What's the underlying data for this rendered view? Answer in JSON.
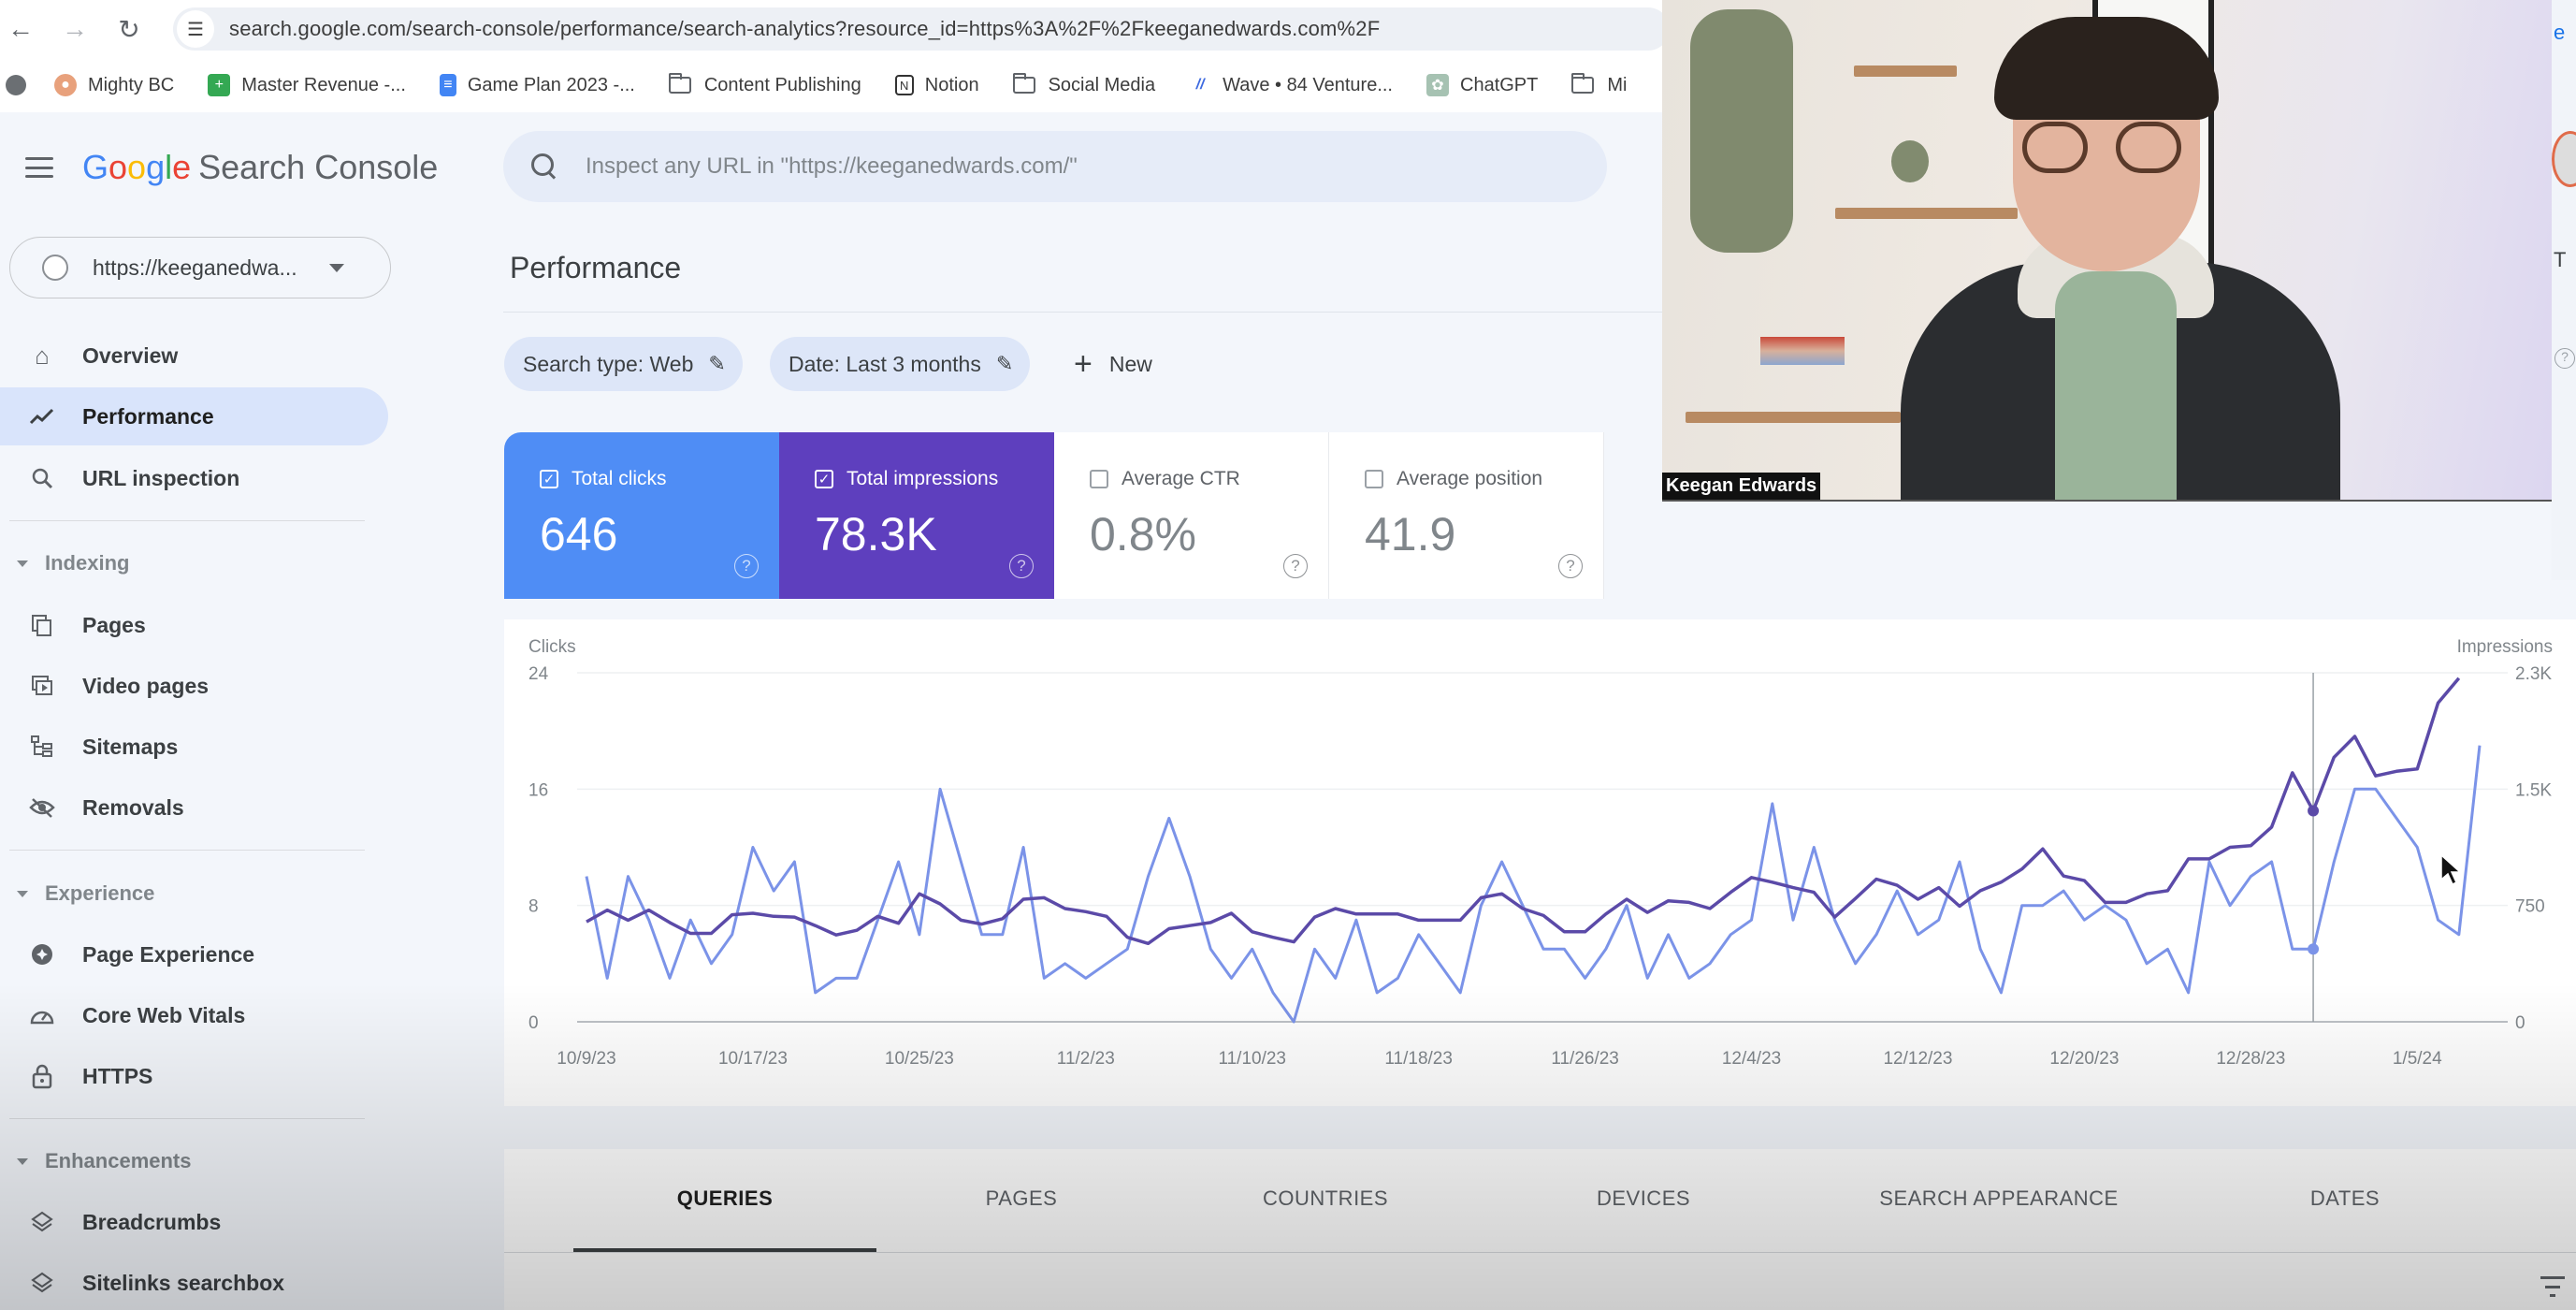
{
  "browser": {
    "url": "search.google.com/search-console/performance/search-analytics?resource_id=https%3A%2F%2Fkeeganedwards.com%2F",
    "bookmarks": [
      {
        "label": "Mighty BC",
        "icon": "mighty-bc-icon",
        "color": "#e8a17c"
      },
      {
        "label": "Master Revenue -...",
        "icon": "sheets-icon",
        "color": "#34a853"
      },
      {
        "label": "Game Plan 2023 -...",
        "icon": "docs-icon",
        "color": "#4285f4"
      },
      {
        "label": "Content Publishing",
        "icon": "folder-icon"
      },
      {
        "label": "Notion",
        "icon": "notion-icon",
        "color": "#333333"
      },
      {
        "label": "Social Media",
        "icon": "folder-icon"
      },
      {
        "label": "Wave • 84 Venture...",
        "icon": "wave-icon",
        "color": "#3d6ae0"
      },
      {
        "label": "ChatGPT",
        "icon": "chatgpt-icon",
        "color": "#a6c2b2"
      },
      {
        "label": "Mi",
        "icon": "folder-icon"
      }
    ]
  },
  "sidebar": {
    "product_name": "Search Console",
    "logo_letters": [
      "G",
      "o",
      "o",
      "g",
      "l",
      "e"
    ],
    "property": "https://keeganedwa...",
    "top_items": [
      {
        "label": "Overview",
        "icon": "home-icon"
      },
      {
        "label": "Performance",
        "icon": "trending-up-icon",
        "active": true
      },
      {
        "label": "URL inspection",
        "icon": "search-icon"
      }
    ],
    "sections": [
      {
        "title": "Indexing",
        "items": [
          {
            "label": "Pages",
            "icon": "pages-icon"
          },
          {
            "label": "Video pages",
            "icon": "video-pages-icon"
          },
          {
            "label": "Sitemaps",
            "icon": "sitemap-icon"
          },
          {
            "label": "Removals",
            "icon": "eye-off-icon"
          }
        ]
      },
      {
        "title": "Experience",
        "items": [
          {
            "label": "Page Experience",
            "icon": "page-experience-icon"
          },
          {
            "label": "Core Web Vitals",
            "icon": "speedometer-icon"
          },
          {
            "label": "HTTPS",
            "icon": "lock-icon"
          }
        ]
      },
      {
        "title": "Enhancements",
        "items": [
          {
            "label": "Breadcrumbs",
            "icon": "layers-icon"
          },
          {
            "label": "Sitelinks searchbox",
            "icon": "layers-icon"
          }
        ]
      }
    ]
  },
  "main": {
    "search_placeholder": "Inspect any URL in \"https://keeganedwards.com/\"",
    "page_title": "Performance",
    "filters": [
      {
        "label": "Search type: Web"
      },
      {
        "label": "Date: Last 3 months"
      }
    ],
    "new_label": "New",
    "metrics": [
      {
        "label": "Total clicks",
        "value": "646",
        "checked": true,
        "color": "#4f8df5"
      },
      {
        "label": "Total impressions",
        "value": "78.3K",
        "checked": true,
        "color": "#5e3fbe"
      },
      {
        "label": "Average CTR",
        "value": "0.8%",
        "checked": false
      },
      {
        "label": "Average position",
        "value": "41.9",
        "checked": false
      }
    ],
    "tabs": [
      {
        "label": "QUERIES",
        "active": true
      },
      {
        "label": "PAGES"
      },
      {
        "label": "COUNTRIES"
      },
      {
        "label": "DEVICES"
      },
      {
        "label": "SEARCH APPEARANCE"
      },
      {
        "label": "DATES"
      }
    ]
  },
  "webcam": {
    "participant_name": "Keegan Edwards"
  },
  "chart_data": {
    "type": "line",
    "title": "",
    "left_axis_label": "Clicks",
    "right_axis_label": "Impressions",
    "left_ylim": [
      0,
      24
    ],
    "left_ticks": [
      "0",
      "8",
      "16",
      "24"
    ],
    "right_ylim": [
      0,
      2250
    ],
    "right_ticks": [
      "0",
      "750",
      "1.5K",
      "2.3K"
    ],
    "x_tick_labels": [
      "10/9/23",
      "10/17/23",
      "10/25/23",
      "11/2/23",
      "11/10/23",
      "11/18/23",
      "11/26/23",
      "12/4/23",
      "12/12/23",
      "12/20/23",
      "12/28/23",
      "1/5/24"
    ],
    "x_tick_every_days": 8,
    "start_date": "10/9/23",
    "end_date": "1/8/24",
    "grid": true,
    "hover_date_index": 83,
    "series": [
      {
        "name": "Clicks",
        "axis": "left",
        "color": "#7b93e8",
        "values": [
          10,
          3,
          10,
          7,
          3,
          7,
          4,
          6,
          12,
          9,
          11,
          2,
          3,
          3,
          7,
          11,
          6,
          16,
          11,
          6,
          6,
          12,
          3,
          4,
          3,
          4,
          5,
          10,
          14,
          10,
          5,
          3,
          5,
          2,
          0,
          5,
          3,
          7,
          2,
          3,
          6,
          4,
          2,
          8,
          11,
          8,
          5,
          5,
          3,
          5,
          8,
          3,
          6,
          3,
          4,
          6,
          7,
          15,
          7,
          12,
          7,
          4,
          6,
          9,
          6,
          7,
          11,
          5,
          2,
          8,
          8,
          9,
          7,
          8,
          7,
          4,
          5,
          2,
          11,
          8,
          10,
          11,
          5,
          5,
          11,
          16,
          16,
          14,
          12,
          7,
          6,
          19
        ]
      },
      {
        "name": "Impressions",
        "axis": "right",
        "color": "#5b4aa8",
        "values": [
          645,
          720,
          655,
          720,
          640,
          570,
          570,
          690,
          700,
          680,
          675,
          620,
          560,
          590,
          680,
          635,
          825,
          760,
          655,
          630,
          665,
          790,
          800,
          730,
          710,
          680,
          545,
          505,
          600,
          620,
          640,
          700,
          580,
          545,
          515,
          675,
          730,
          695,
          695,
          695,
          655,
          655,
          655,
          800,
          825,
          730,
          685,
          580,
          580,
          695,
          790,
          705,
          780,
          770,
          730,
          835,
          930,
          900,
          865,
          835,
          675,
          795,
          920,
          880,
          790,
          865,
          745,
          845,
          900,
          985,
          1115,
          940,
          910,
          770,
          770,
          825,
          845,
          1050,
          1050,
          1125,
          1135,
          1255,
          1605,
          1360,
          1705,
          1840,
          1585,
          1615,
          1630,
          2055,
          2215
        ]
      }
    ]
  }
}
